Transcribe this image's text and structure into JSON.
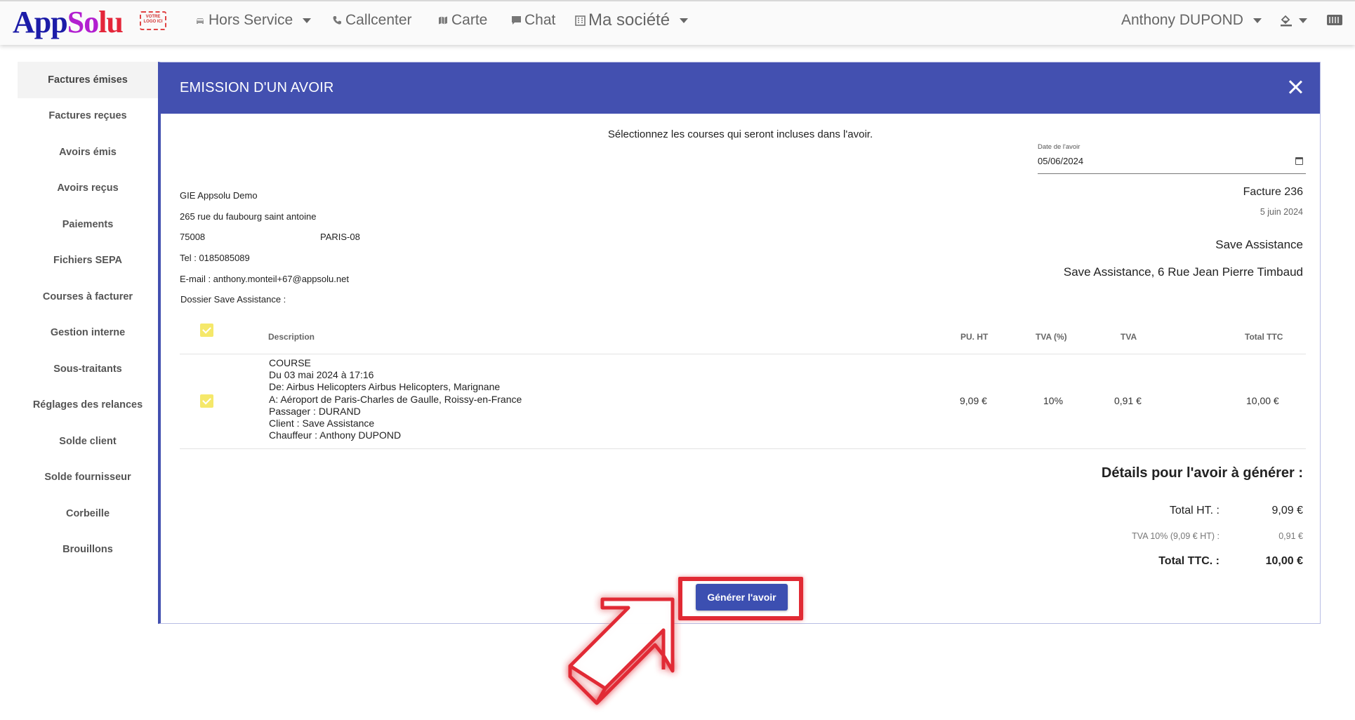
{
  "navbar": {
    "logo_part1": "App",
    "logo_part2": "So",
    "logo_part3": "lu",
    "logo_stamp": "VOTRE LOGO ICI",
    "items": [
      {
        "label": "Hors Service",
        "icon": "car-icon"
      },
      {
        "label": "Callcenter",
        "icon": "phone-icon"
      },
      {
        "label": "Carte",
        "icon": "map-icon"
      },
      {
        "label": "Chat",
        "icon": "chat-icon"
      },
      {
        "label": "Ma société",
        "icon": "building-icon"
      }
    ],
    "user": "Anthony DUPOND"
  },
  "sidebar": {
    "items": [
      {
        "label": "Factures émises"
      },
      {
        "label": "Factures reçues"
      },
      {
        "label": "Avoirs émis"
      },
      {
        "label": "Avoirs reçus"
      },
      {
        "label": "Paiements"
      },
      {
        "label": "Fichiers SEPA"
      },
      {
        "label": "Courses à facturer"
      },
      {
        "label": "Gestion interne"
      },
      {
        "label": "Sous-traitants"
      },
      {
        "label": "Réglages des relances"
      },
      {
        "label": "Solde client"
      },
      {
        "label": "Solde fournisseur"
      },
      {
        "label": "Corbeille"
      },
      {
        "label": "Brouillons"
      }
    ]
  },
  "modal": {
    "title": "EMISSION D'UN AVOIR",
    "instruction": "Sélectionnez les courses qui seront incluses dans l'avoir.",
    "date_label": "Date de l'avoir",
    "date_value": "05/06/2024",
    "company": {
      "name": "GIE Appsolu Demo",
      "street": "265 rue du faubourg saint antoine",
      "zip": "75008",
      "city": "PARIS-08",
      "tel": "Tel : 0185085089",
      "email": "E-mail : anthony.monteil+67@appsolu.net",
      "dossier": "Dossier Save Assistance :"
    },
    "invoice": {
      "number": "Facture 236",
      "date": "5 juin 2024",
      "client": "Save Assistance",
      "client_address": "Save Assistance, 6 Rue Jean Pierre Timbaud"
    },
    "table": {
      "headers": {
        "description": "Description",
        "pu_ht": "PU. HT",
        "tva_pct": "TVA (%)",
        "tva": "TVA",
        "total_ttc": "Total TTC"
      },
      "row": {
        "type": "COURSE",
        "date": "Du 03 mai 2024 à 17:16",
        "from": "De: Airbus Helicopters Airbus Helicopters, Marignane",
        "to": "A: Aéroport de Paris-Charles de Gaulle, Roissy-en-France",
        "passenger": "Passager : DURAND",
        "client": "Client : Save Assistance",
        "driver": "Chauffeur : Anthony DUPOND",
        "pu_ht": "9,09 €",
        "tva_pct": "10%",
        "tva": "0,91 €",
        "total_ttc": "10,00 €"
      }
    },
    "details": {
      "title": "Détails pour l'avoir à générer :",
      "total_ht_label": "Total HT. :",
      "total_ht_value": "9,09 €",
      "tva_label": "TVA 10% (9,09 € HT) :",
      "tva_value": "0,91 €",
      "total_ttc_label": "Total TTC. :",
      "total_ttc_value": "10,00 €"
    },
    "generate_button": "Générer l'avoir"
  },
  "colors": {
    "primary": "#4350b0",
    "checkbox": "#f5e86a",
    "highlight": "#e12a34"
  }
}
